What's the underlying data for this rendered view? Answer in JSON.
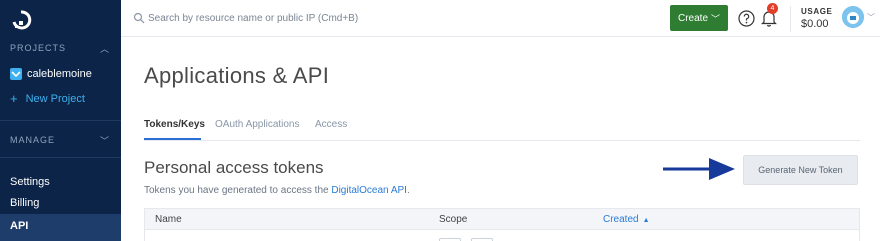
{
  "sidebar": {
    "projects_heading": "PROJECTS",
    "project_name": "calebl​emoine",
    "new_project": "New Project",
    "manage_heading": "MANAGE",
    "links": [
      "Settings",
      "Billing"
    ],
    "active_link": "API"
  },
  "topbar": {
    "search_placeholder": "Search by resource name or public IP (Cmd+B)",
    "create_label": "Create",
    "notification_count": "4",
    "usage_label": "USAGE",
    "usage_value": "$0.00"
  },
  "main": {
    "title": "Applications & API",
    "tabs": [
      "Tokens/Keys",
      "OAuth Applications",
      "Access"
    ],
    "section_title": "Personal access tokens",
    "section_desc_prefix": "Tokens you have generated to access the ",
    "section_desc_link": "DigitalOcean API",
    "section_desc_suffix": ".",
    "generate_button": "Generate New Token",
    "table": {
      "columns": [
        "Name",
        "Scope",
        "Created"
      ],
      "sorted_column": "Created"
    }
  },
  "colors": {
    "sidebar_bg": "#0b2447",
    "create_green": "#2e7d32",
    "accent_blue": "#2b7bd8",
    "arrow_navy": "#16399a"
  },
  "icons": [
    "digitalocean-logo-icon",
    "search-icon",
    "help-icon",
    "bell-icon",
    "avatar-icon",
    "arrow-right-icon",
    "chevron-down-icon"
  ]
}
